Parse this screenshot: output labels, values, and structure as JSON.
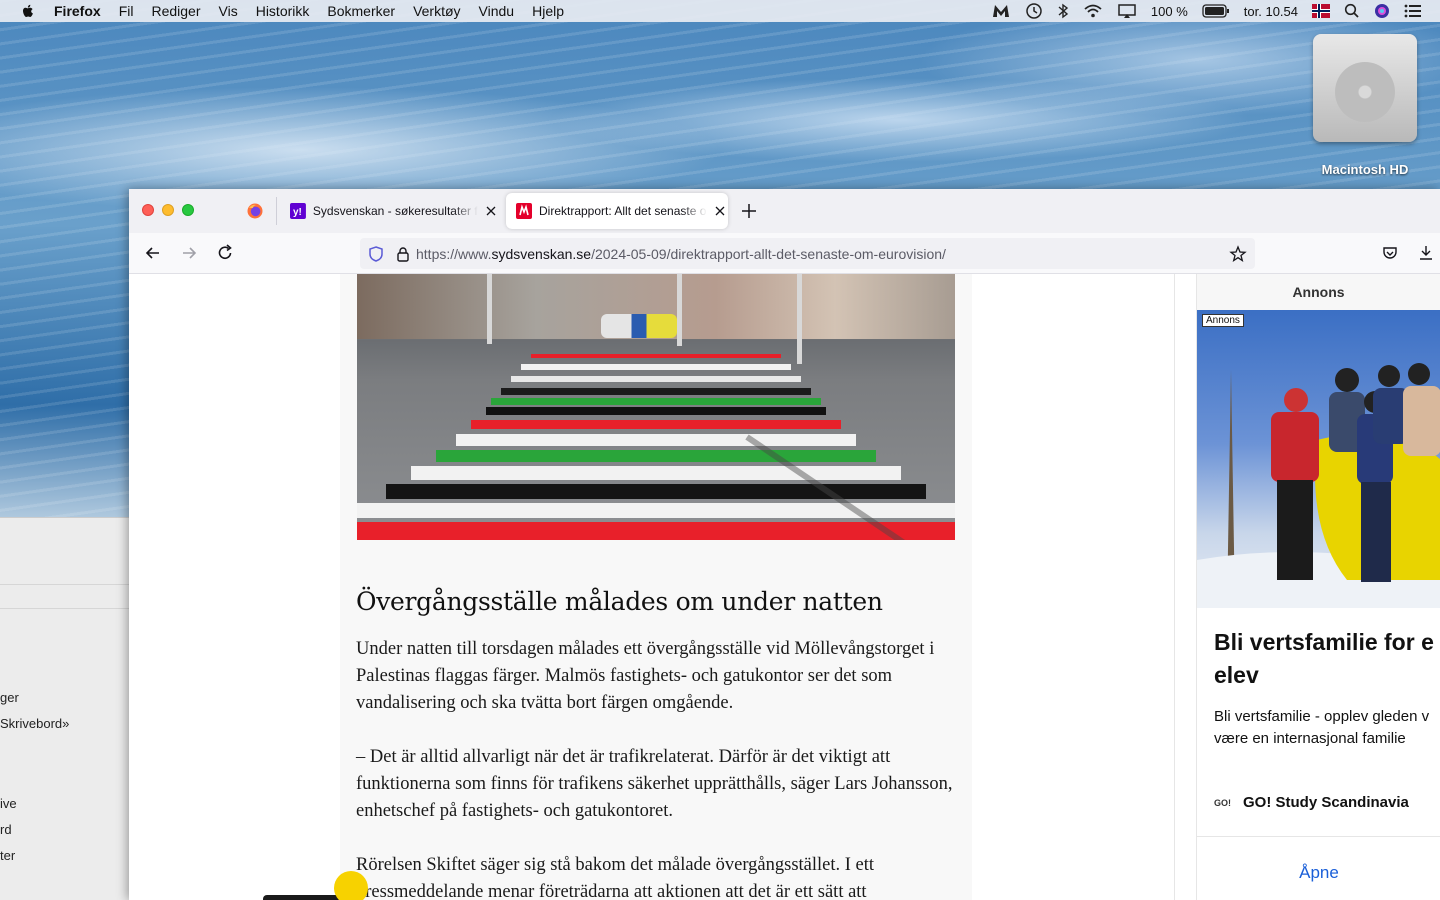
{
  "menubar": {
    "app": "Firefox",
    "items": [
      "Fil",
      "Rediger",
      "Vis",
      "Historikk",
      "Bokmerker",
      "Verktøy",
      "Vindu",
      "Hjelp"
    ],
    "battery": "100 %",
    "clock": "tor. 10.54"
  },
  "desktop": {
    "disk_label": "Macintosh HD"
  },
  "finder": {
    "items": [
      "ger",
      "Skrivebord»",
      "ive",
      "rd",
      "ter"
    ]
  },
  "browser": {
    "tabs": [
      {
        "title": "Sydsvenskan - søkeresultater fra Yahoo"
      },
      {
        "title": "Direktrapport: Allt det senaste om Eurovision"
      }
    ],
    "url_prefix": "https://www.",
    "url_domain": "sydsvenskan.se",
    "url_path": "/2024-05-09/direktrapport-allt-det-senaste-om-eurovision/"
  },
  "article": {
    "headline": "Övergångsställe målades om under natten",
    "p1": "Under natten till torsdagen målades ett övergångsställe vid Möllevångstorget i Palestinas flaggas färger. Malmös fastighets- och gatukontor ser det som vandalisering och ska tvätta bort färgen omgående.",
    "p2": "– Det är alltid allvarligt när det är trafikrelaterat. Därför är det viktigt att funktionerna som finns för trafikens säkerhet upprätthålls, säger Lars Johansson, enhetschef på fastighets- och gatukontoret.",
    "p3": "Rörelsen Skiftet säger sig stå bakom det målade övergångsstället. I ett pressmeddelande menar företrädarna att aktionen att det är ett sätt att"
  },
  "ad": {
    "header": "Annons",
    "badge": "Annons",
    "title_line1": "Bli vertsfamilie for e",
    "title_line2": "elev",
    "desc_line1": "Bli vertsfamilie - opplev gleden v",
    "desc_line2": "være en internasjonal familie",
    "brand_logo": "GO!",
    "brand": "GO! Study Scandinavia",
    "cta": "Åpne"
  },
  "colors": {
    "accent_link": "#1a5fd8",
    "flag_red": "#e8202a",
    "flag_green": "#2aa53a",
    "flag_black": "#111111"
  }
}
